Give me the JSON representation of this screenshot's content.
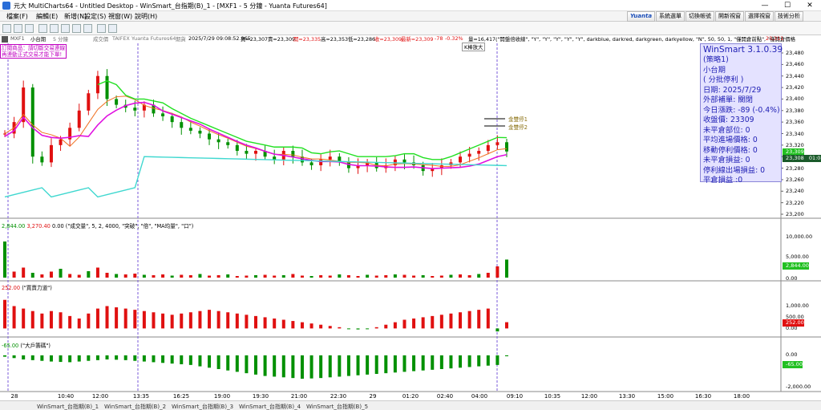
{
  "window": {
    "title": "元大 MultiCharts64 - Untitled Desktop - WinSmart_台指期(B)_1 - [MXF1 - 5 分鐘 - Yuanta Futures64]",
    "minimize": "—",
    "maximize": "☐",
    "close": "✕"
  },
  "menu": {
    "items": [
      "檔案(F)",
      "編輯(E)",
      "新增(N)",
      "設定(S)",
      "視窗(W)",
      "說明(H)"
    ],
    "right_buttons": [
      "Yuanta",
      "系統選單",
      "切換帳號",
      "開新視窗",
      "選擇視窗",
      "技術分析"
    ]
  },
  "chart_header": {
    "symbol": "MXF1",
    "name": "小台期",
    "interval": "5 分鐘",
    "timing": "成交價",
    "exchange": "TAIFEX",
    "datafeed": "Yuanta Futures64",
    "period": "期貨",
    "datetime": "2025/7/29  09:08:52.965",
    "bid": "買=23,307",
    "ask": "賣=23,309",
    "open": "開=23,335",
    "high": "高=23,353",
    "low": "低=23,286",
    "close": "收=23,309",
    "last": "最新=23,309",
    "chg": "-78",
    "chg_pct": "-0.32%",
    "volume": "量=16,417",
    "study_params": "(\"開盤倍收線\", \"Y\", \"Y\", \"Y\", \"Y\", \"Y\", darkblue, darkred, darkgreen, darkyellow, \"N\", 50, 50, 1, \"僅開倉前點\", \"僅開倉價格",
    "price_tag": "23,311",
    "zoom_tooltip": "K棒放大"
  },
  "notes": {
    "line1": "訂閱商品：請切斷交易連線",
    "line2": "再連動正式交易才能下單!"
  },
  "stop_labels": [
    "金雙停1",
    "金雙停2"
  ],
  "info_panel": {
    "title": "WinSmart 3.1.0.39",
    "strategy": "(策略1)",
    "product": "小台期",
    "mode": "( 分批停利 )",
    "date": "日期: 2025/7/29",
    "ext": "外部補單: 關閉",
    "today": "今日漲跌: -89 (-0.4%)",
    "close": "收盤價: 23309",
    "pos": "未平倉部位: 0",
    "avg": "平均進場價格: 0",
    "trail": "移動停利價格: 0",
    "unreal": "未平倉損益: 0",
    "tp": "停利線出場損益: 0",
    "real": "平倉損益 :0"
  },
  "price_axis": [
    "23,480",
    "23,460",
    "23,440",
    "23,420",
    "23,400",
    "23,380",
    "23,360",
    "23,340",
    "23,320",
    "23,300",
    "23,280",
    "23,260",
    "23,240",
    "23,220",
    "23,200"
  ],
  "price_tags": {
    "green": "23,309",
    "dark": "23,308",
    "dark2": "01:08"
  },
  "volume_panel": {
    "header_green": "2,844.00",
    "header_red": "3,270.40",
    "header_zero": "0.00",
    "params": "(\"成交量\", 5, 2, 4000, \"突破\", \"倍\", \"MA均量\", \"口\")",
    "axis": [
      "10,000.00",
      "5,000.00",
      "0.00"
    ],
    "tag": "2,844.00"
  },
  "power_panel": {
    "header_val": "252.00",
    "params": "(\"買賣力道\")",
    "axis": [
      "1,000.00",
      "500.00",
      "0.00"
    ],
    "tag": "252.00"
  },
  "big_panel": {
    "header_val": "-65.00",
    "params": "(\"大戶籌碼\")",
    "axis": [
      "0.00",
      "-2,000.00"
    ],
    "tag": "-65.00"
  },
  "time_axis": [
    "28",
    "10:40",
    "12:00",
    "13:35",
    "16:25",
    "19:00",
    "19:30",
    "21:00",
    "22:30",
    "29",
    "01:20",
    "02:40",
    "04:00",
    "09:10",
    "10:35",
    "12:00",
    "13:30",
    "15:00",
    "16:30",
    "18:00"
  ],
  "statusbar": [
    "WinSmart_台指期(B)_1",
    "WinSmart_台指期(B)_2",
    "WinSmart_台指期(B)_3",
    "WinSmart_台指期(B)_4",
    "WinSmart_台指期(B)_5"
  ],
  "colors": {
    "up": "#e01010",
    "down": "#009000",
    "ma_magenta": "#e010e0",
    "ma_orange": "#f07020",
    "line_green": "#22e022",
    "line_cyan": "#40d8d0",
    "info_bg": "#e4e2ff",
    "info_text": "#2121b5"
  },
  "chart_data": [
    {
      "type": "candlestick",
      "title": "MXF1 - 5 分鐘",
      "ylim": [
        23200,
        23480
      ],
      "series": [
        {
          "name": "close",
          "values": [
            23340,
            23360,
            23420,
            23300,
            23290,
            23320,
            23330,
            23350,
            23380,
            23410,
            23440,
            23400,
            23390,
            23385,
            23380,
            23390,
            23375,
            23370,
            23360,
            23350,
            23345,
            23340,
            23330,
            23325,
            23320,
            23310,
            23305,
            23310,
            23300,
            23295,
            23310,
            23300,
            23290,
            23285,
            23295,
            23300,
            23290,
            23280,
            23285,
            23290,
            23280,
            23285,
            23295,
            23290,
            23285,
            23275,
            23280,
            23285,
            23290,
            23300,
            23305,
            23310,
            23320,
            23325,
            23309
          ]
        }
      ]
    },
    {
      "type": "bar",
      "title": "成交量",
      "ylim": [
        0,
        12000
      ],
      "values": [
        9000,
        1500,
        2500,
        1200,
        800,
        1500,
        2200,
        900,
        700,
        1600,
        2500,
        1200,
        900,
        800,
        1000,
        700,
        600,
        800,
        500,
        700,
        600,
        900,
        500,
        600,
        800,
        400,
        500,
        600,
        700,
        500,
        600,
        900,
        500,
        400,
        600,
        500,
        800,
        600,
        400,
        700,
        500,
        600,
        800,
        700,
        500,
        600,
        400,
        500,
        700,
        800,
        600,
        900,
        1200,
        2800,
        4500
      ]
    },
    {
      "type": "bar",
      "title": "買賣力道",
      "ylim": [
        -150,
        1400
      ],
      "values": [
        1150,
        900,
        800,
        700,
        600,
        700,
        650,
        500,
        400,
        600,
        800,
        900,
        850,
        800,
        750,
        700,
        650,
        600,
        550,
        600,
        650,
        700,
        750,
        700,
        650,
        600,
        550,
        500,
        450,
        400,
        350,
        300,
        250,
        200,
        150,
        100,
        50,
        -30,
        -40,
        -20,
        50,
        150,
        250,
        350,
        400,
        450,
        500,
        550,
        600,
        650,
        700,
        750,
        800,
        -120,
        252
      ]
    },
    {
      "type": "bar",
      "title": "大戶籌碼",
      "ylim": [
        -2400,
        400
      ],
      "values": [
        -100,
        -200,
        -300,
        -350,
        -400,
        -450,
        -480,
        -500,
        -450,
        -400,
        -350,
        -300,
        -320,
        -350,
        -400,
        -450,
        -500,
        -550,
        -600,
        -650,
        -700,
        -800,
        -900,
        -1000,
        -1100,
        -1200,
        -1300,
        -1400,
        -1500,
        -1550,
        -1600,
        -1650,
        -1700,
        -1680,
        -1650,
        -1600,
        -1550,
        -1500,
        -1450,
        -1400,
        -1350,
        -1300,
        -1250,
        -1200,
        -1150,
        -1100,
        -1050,
        -1000,
        -950,
        -900,
        -850,
        -800,
        -750,
        -700,
        -65
      ]
    }
  ]
}
